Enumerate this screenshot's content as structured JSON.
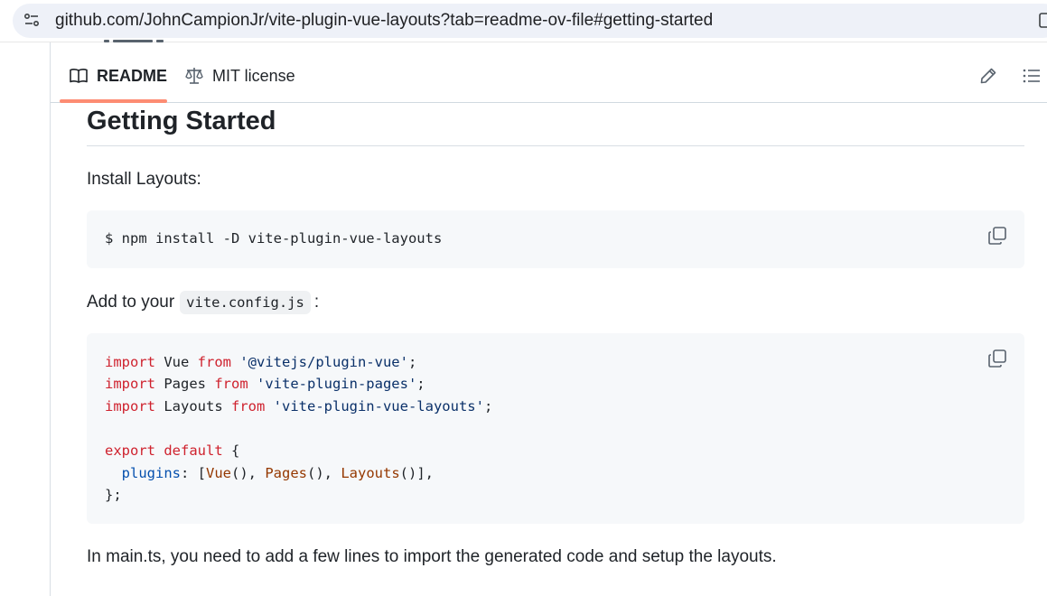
{
  "browser": {
    "url": "github.com/JohnCampionJr/vite-plugin-vue-layouts?tab=readme-ov-file#getting-started",
    "site_info_icon": "tune-icon"
  },
  "readme_header": {
    "tabs": [
      {
        "label": "README",
        "icon": "book-icon",
        "active": true
      },
      {
        "label": "MIT license",
        "icon": "scale-icon",
        "active": false
      }
    ],
    "edit_icon": "pencil-icon",
    "outline_icon": "list-unordered-icon",
    "active_tab_color": "#fd8c73"
  },
  "content": {
    "heading": "Getting Started",
    "install_text": "Install Layouts:",
    "install_cmd": "$ npm install -D vite-plugin-vue-layouts",
    "add_to_prefix": "Add to your",
    "add_to_code": "vite.config.js",
    "add_to_suffix": ":",
    "config_code": {
      "line1": {
        "kw": "import",
        "ident": " Vue ",
        "kw2": "from",
        "str": " '@vitejs/plugin-vue'",
        "end": ";"
      },
      "line2": {
        "kw": "import",
        "ident": " Pages ",
        "kw2": "from",
        "str": " 'vite-plugin-pages'",
        "end": ";"
      },
      "line3": {
        "kw": "import",
        "ident": " Layouts ",
        "kw2": "from",
        "str": " 'vite-plugin-vue-layouts'",
        "end": ";"
      },
      "line5": {
        "kw": "export",
        "kw2": " default",
        "end": " {"
      },
      "line6": {
        "indent": "  ",
        "prop": "plugins",
        "colon": ": [",
        "c1": "Vue",
        "p1": "(), ",
        "c2": "Pages",
        "p2": "(), ",
        "c3": "Layouts",
        "p3": "()],"
      },
      "line7": "};"
    },
    "main_ts_text": "In main.ts, you need to add a few lines to import the generated code and setup the layouts."
  },
  "colors": {
    "keyword": "#cf222e",
    "string": "#0a3069",
    "property": "#0550ae",
    "call": "#953800",
    "code_bg": "#f6f8fa"
  }
}
